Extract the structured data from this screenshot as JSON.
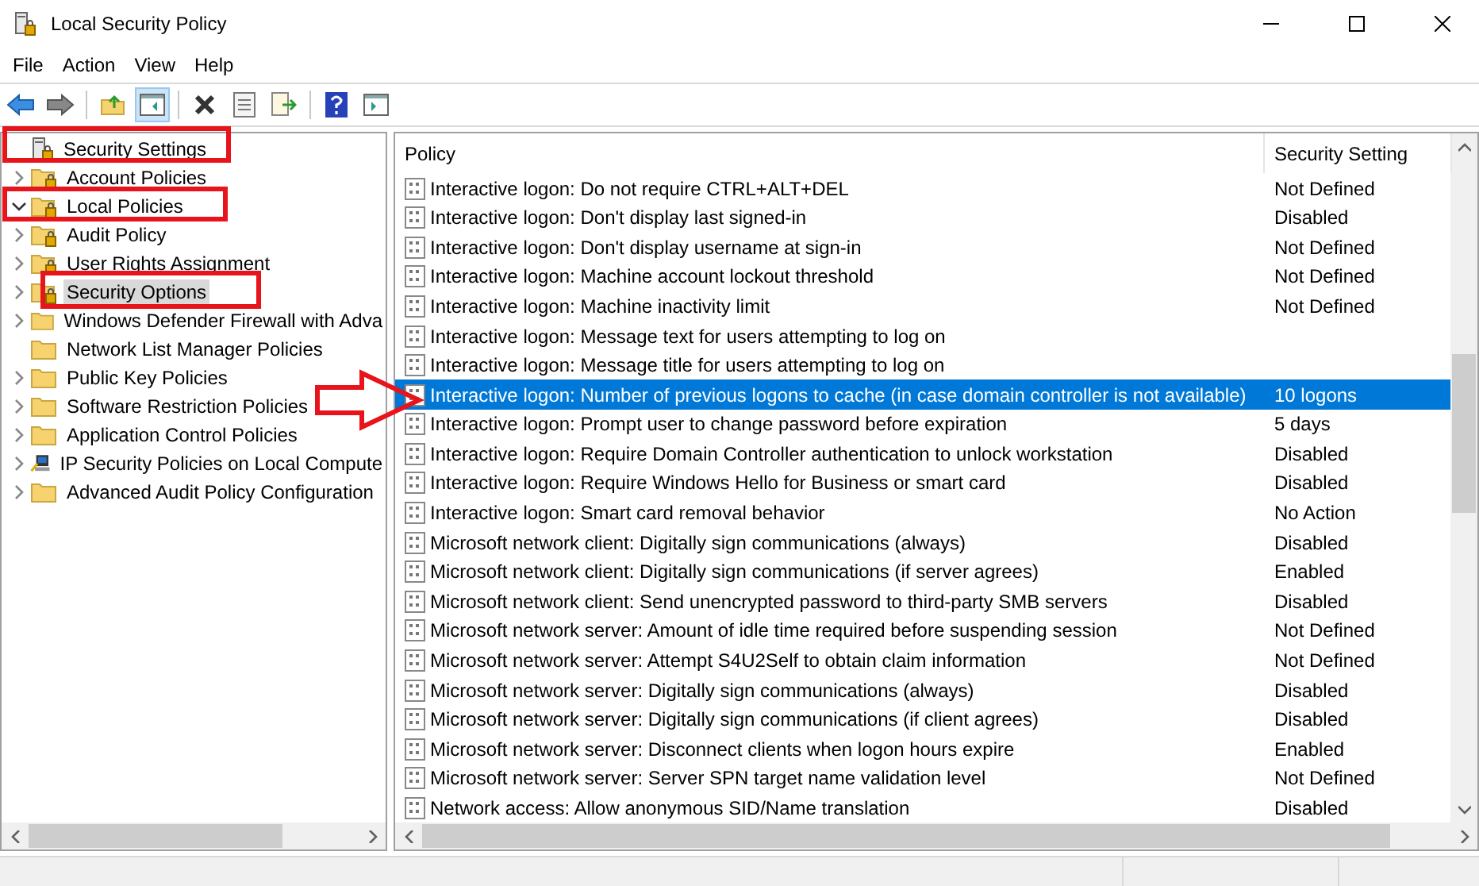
{
  "window": {
    "title": "Local Security Policy"
  },
  "menu": [
    "File",
    "Action",
    "View",
    "Help"
  ],
  "tree": {
    "label": "Security Settings",
    "kind": "root",
    "selected": false,
    "children": [
      {
        "label": "Account Policies",
        "kind": "secured",
        "expanded": false,
        "selected": false
      },
      {
        "label": "Local Policies",
        "kind": "secured",
        "expanded": true,
        "selected": false,
        "children": [
          {
            "label": "Audit Policy",
            "kind": "secured",
            "expanded": false,
            "selected": false
          },
          {
            "label": "User Rights Assignment",
            "kind": "secured",
            "expanded": false,
            "selected": false
          },
          {
            "label": "Security Options",
            "kind": "secured",
            "expanded": false,
            "selected": true
          }
        ]
      },
      {
        "label": "Windows Defender Firewall with Adva",
        "kind": "plain",
        "expanded": false,
        "selected": false
      },
      {
        "label": "Network List Manager Policies",
        "kind": "plain",
        "selected": false
      },
      {
        "label": "Public Key Policies",
        "kind": "plain",
        "expanded": false,
        "selected": false
      },
      {
        "label": "Software Restriction Policies",
        "kind": "plain",
        "expanded": false,
        "selected": false
      },
      {
        "label": "Application Control Policies",
        "kind": "plain",
        "expanded": false,
        "selected": false
      },
      {
        "label": "IP Security Policies on Local Compute",
        "kind": "ipsec",
        "expanded": false,
        "selected": false
      },
      {
        "label": "Advanced Audit Policy Configuration",
        "kind": "plain",
        "expanded": false,
        "selected": false
      }
    ]
  },
  "table": {
    "columns": [
      "Policy",
      "Security Setting"
    ],
    "rows": [
      {
        "policy": "Interactive logon: Do not require CTRL+ALT+DEL",
        "setting": "Not Defined",
        "selected": false
      },
      {
        "policy": "Interactive logon: Don't display last signed-in",
        "setting": "Disabled",
        "selected": false
      },
      {
        "policy": "Interactive logon: Don't display username at sign-in",
        "setting": "Not Defined",
        "selected": false
      },
      {
        "policy": "Interactive logon: Machine account lockout threshold",
        "setting": "Not Defined",
        "selected": false
      },
      {
        "policy": "Interactive logon: Machine inactivity limit",
        "setting": "Not Defined",
        "selected": false
      },
      {
        "policy": "Interactive logon: Message text for users attempting to log on",
        "selected": false
      },
      {
        "policy": "Interactive logon: Message title for users attempting to log on",
        "selected": false
      },
      {
        "policy": "Interactive logon: Number of previous logons to cache (in case domain controller is not available)",
        "setting": "10 logons",
        "selected": true
      },
      {
        "policy": "Interactive logon: Prompt user to change password before expiration",
        "setting": "5 days",
        "selected": false
      },
      {
        "policy": "Interactive logon: Require Domain Controller authentication to unlock workstation",
        "setting": "Disabled",
        "selected": false
      },
      {
        "policy": "Interactive logon: Require Windows Hello for Business or smart card",
        "setting": "Disabled",
        "selected": false
      },
      {
        "policy": "Interactive logon: Smart card removal behavior",
        "setting": "No Action",
        "selected": false
      },
      {
        "policy": "Microsoft network client: Digitally sign communications (always)",
        "setting": "Disabled",
        "selected": false
      },
      {
        "policy": "Microsoft network client: Digitally sign communications (if server agrees)",
        "setting": "Enabled",
        "selected": false
      },
      {
        "policy": "Microsoft network client: Send unencrypted password to third-party SMB servers",
        "setting": "Disabled",
        "selected": false
      },
      {
        "policy": "Microsoft network server: Amount of idle time required before suspending session",
        "setting": "Not Defined",
        "selected": false
      },
      {
        "policy": "Microsoft network server: Attempt S4U2Self to obtain claim information",
        "setting": "Not Defined",
        "selected": false
      },
      {
        "policy": "Microsoft network server: Digitally sign communications (always)",
        "setting": "Disabled",
        "selected": false
      },
      {
        "policy": "Microsoft network server: Digitally sign communications (if client agrees)",
        "setting": "Disabled",
        "selected": false
      },
      {
        "policy": "Microsoft network server: Disconnect clients when logon hours expire",
        "setting": "Enabled",
        "selected": false
      },
      {
        "policy": "Microsoft network server: Server SPN target name validation level",
        "setting": "Not Defined",
        "selected": false
      },
      {
        "policy": "Network access: Allow anonymous SID/Name translation",
        "setting": "Disabled",
        "selected": false
      }
    ]
  }
}
